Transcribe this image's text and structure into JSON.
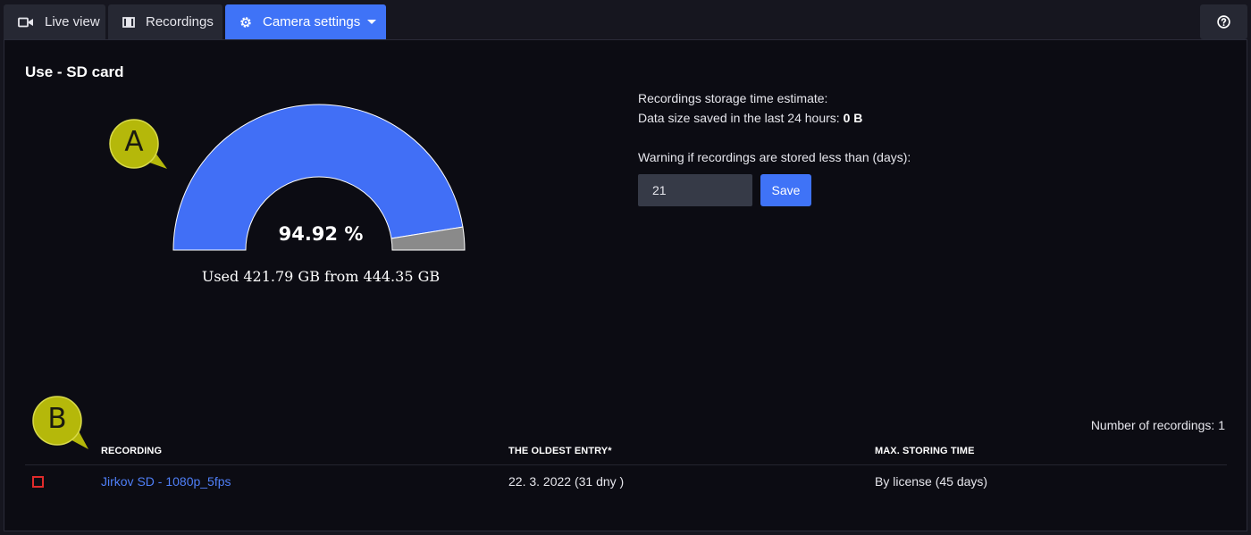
{
  "tabs": [
    {
      "label": "Live view",
      "icon": "video-camera-icon"
    },
    {
      "label": "Recordings",
      "icon": "film-icon"
    },
    {
      "label": "Camera settings",
      "icon": "gear-icon",
      "active": true
    }
  ],
  "help_icon": "question-circle-icon",
  "section": {
    "title": "Use - SD card"
  },
  "callouts": {
    "a": "A",
    "b": "B"
  },
  "gauge": {
    "percent_label": "94.92 %",
    "used_label": "Used 421.79 GB from 444.35 GB",
    "used_fraction": 0.9492,
    "used_color": "#416ff6",
    "free_color": "#8a8a8a"
  },
  "storage": {
    "estimate_label": "Recordings storage time estimate:",
    "data_size_label": "Data size saved in the last 24 hours:",
    "data_size_value": "0 B",
    "warning_label": "Warning if recordings are stored less than (days):",
    "warning_value": "21",
    "save_label": "Save"
  },
  "recordings": {
    "count_label": "Number of recordings: 1",
    "columns": [
      "RECORDING",
      "THE OLDEST ENTRY*",
      "MAX. STORING TIME"
    ],
    "rows": [
      {
        "name": "Jirkov SD - 1080p_5fps",
        "oldest": "22. 3. 2022 (31 dny )",
        "max": "By license (45 days)"
      }
    ]
  },
  "colors": {
    "accent": "#3f73f7",
    "status_error": "#e02b2b",
    "callout": "#b5b80a"
  }
}
